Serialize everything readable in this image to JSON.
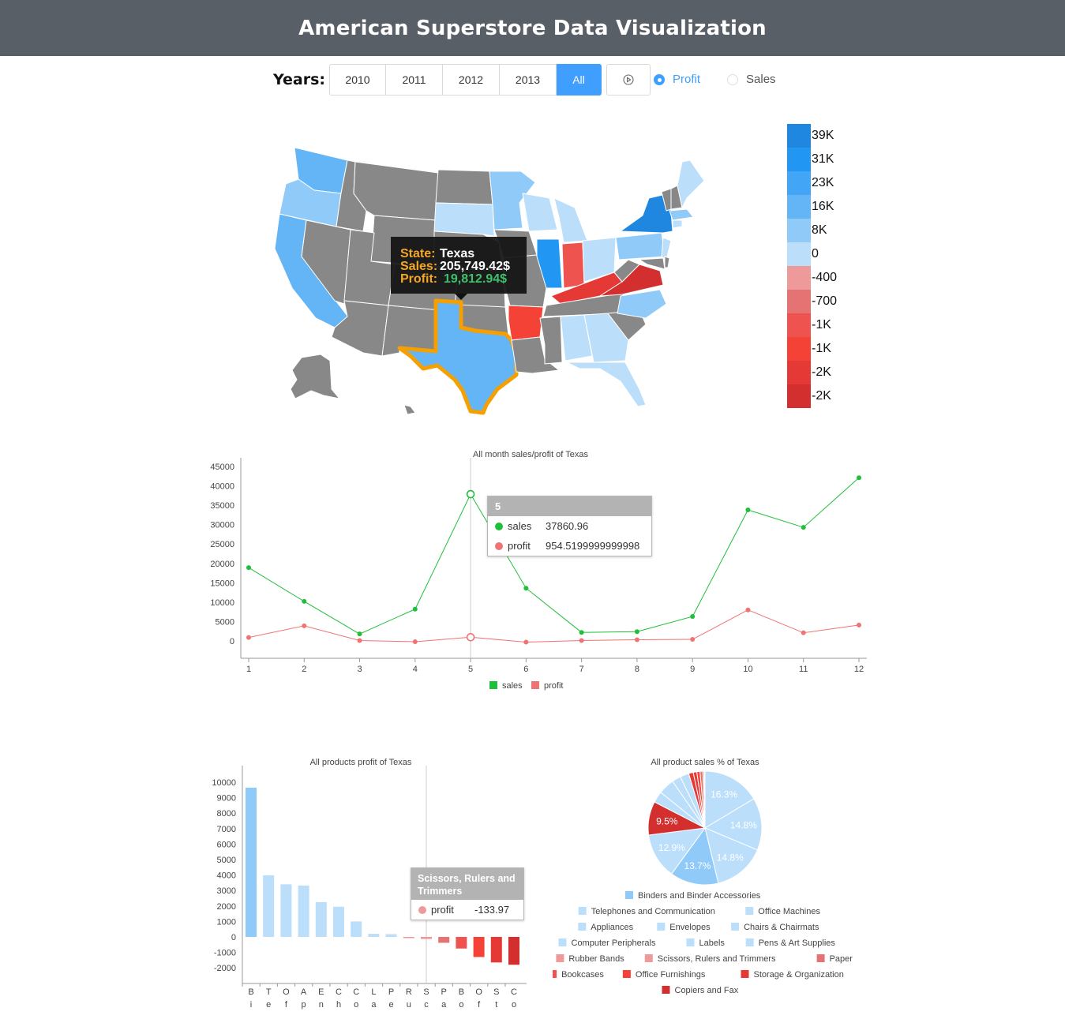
{
  "header": {
    "title": "American Superstore Data Visualization"
  },
  "controls": {
    "years_label": "Years:",
    "years": [
      "2010",
      "2011",
      "2012",
      "2013",
      "All"
    ],
    "selected_year": "All",
    "play_icon": "play-circle-icon",
    "radios": [
      {
        "label": "Profit",
        "checked": true
      },
      {
        "label": "Sales",
        "checked": false
      }
    ]
  },
  "colors": {
    "accent": "#409eff",
    "sales_line": "#1fbf3b",
    "profit_line": "#f07373",
    "tooltip_orange": "#f5a623",
    "tooltip_green": "#3fc06a",
    "highlight_state": "#f5a000",
    "no_data_state": "#888888"
  },
  "map": {
    "legend": [
      "39K",
      "31K",
      "23K",
      "16K",
      "8K",
      "0",
      "-400",
      "-700",
      "-1K",
      "-1K",
      "-2K",
      "-2K"
    ],
    "legend_colors": [
      "#1f87e0",
      "#2196f3",
      "#42a5f5",
      "#64b5f6",
      "#90caf9",
      "#bbdefb",
      "#ef9a9a",
      "#e57373",
      "#ef5350",
      "#f44336",
      "#e53935",
      "#d32f2f"
    ],
    "tooltip": {
      "state_label": "State:",
      "state_value": "Texas",
      "sales_label": "Sales:",
      "sales_value": "205,749.42$",
      "profit_label": "Profit:",
      "profit_value": "19,812.94$"
    }
  },
  "line_tooltip": {
    "title": "5",
    "rows": [
      {
        "name": "sales",
        "value": "37860.96"
      },
      {
        "name": "profit",
        "value": "954.5199999999998"
      }
    ]
  },
  "bar_tooltip": {
    "title": "Scissors, Rulers and Trimmers",
    "name": "profit",
    "value": "-133.97"
  },
  "chart_data": [
    {
      "type": "line",
      "title": "All month sales/profit of Texas",
      "x": [
        1,
        2,
        3,
        4,
        5,
        6,
        7,
        8,
        9,
        10,
        11,
        12
      ],
      "ylim": [
        0,
        45000
      ],
      "yticks": [
        0,
        5000,
        10000,
        15000,
        20000,
        25000,
        30000,
        35000,
        40000,
        45000
      ],
      "series": [
        {
          "name": "sales",
          "values": [
            18900,
            10200,
            1800,
            8200,
            37860.96,
            13600,
            2200,
            2400,
            6300,
            33800,
            29300,
            42100
          ]
        },
        {
          "name": "profit",
          "values": [
            900,
            3900,
            100,
            -200,
            954.52,
            -300,
            100,
            300,
            400,
            8000,
            2100,
            4100
          ]
        }
      ],
      "legend": [
        "sales",
        "profit"
      ],
      "legend_position": "bottom"
    },
    {
      "type": "bar",
      "title": "All products profit of Texas",
      "categories": [
        "Binders and Binder Accessories",
        "Telephones and Communication",
        "Office Machines",
        "Appliances",
        "Envelopes",
        "Chairs & Chairmats",
        "Computer Peripherals",
        "Labels",
        "Pens & Art Supplies",
        "Rubber Bands",
        "Scissors, Rulers and Trimmers",
        "Paper",
        "Bookcases",
        "Office Furnishings",
        "Storage & Organization",
        "Copiers and Fax"
      ],
      "tick_labels": [
        "B\ni",
        "T\ne",
        "O\nf",
        "A\np",
        "E\nn",
        "C\nh",
        "C\no",
        "L\na",
        "P\ne",
        "R\nu",
        "S\nc",
        "P\na",
        "B\no",
        "O\nf",
        "S\nt",
        "C\no"
      ],
      "values": [
        9650,
        3980,
        3400,
        3320,
        2250,
        1950,
        1000,
        200,
        180,
        -5,
        -133.97,
        -380,
        -750,
        -1300,
        -1650,
        -1800
      ],
      "ylim": [
        -2500,
        10500
      ],
      "yticks": [
        -2000,
        -1000,
        0,
        1000,
        2000,
        3000,
        4000,
        5000,
        6000,
        7000,
        8000,
        9000,
        10000
      ]
    },
    {
      "type": "pie",
      "title": "All product sales % of Texas",
      "labels": [
        "Binders and Binder Accessories",
        "Telephones and Communication",
        "Office Machines",
        "Appliances",
        "Envelopes",
        "Chairs & Chairmats",
        "Computer Peripherals",
        "Labels",
        "Pens & Art Supplies",
        "Rubber Bands",
        "Scissors, Rulers and Trimmers",
        "Paper",
        "Bookcases",
        "Office Furnishings",
        "Storage & Organization",
        "Copiers and Fax"
      ],
      "values": [
        16.3,
        14.8,
        14.8,
        13.7,
        12.9,
        9.5,
        4.5,
        3.2,
        2.5,
        2.5,
        1.4,
        1.0,
        0.9,
        0.8,
        0.6,
        0.6
      ],
      "slice_order": [
        "Binders and Binder Accessories",
        "Office Machines",
        "Telephones and Communication",
        "Chairs & Chairmats",
        "Computer Peripherals",
        "Appliances",
        "Copiers and Fax",
        "Envelopes",
        "Labels",
        "Pens & Art Supplies",
        "Office Furnishings",
        "Storage & Organization",
        "Bookcases",
        "Paper",
        "Scissors, Rulers and Trimmers",
        "Rubber Bands"
      ],
      "slice_values": [
        16.3,
        14.8,
        14.8,
        13.7,
        12.9,
        9.5,
        3.2,
        4.5,
        2.5,
        2.5,
        1.3,
        1.0,
        0.9,
        0.8,
        0.4,
        0.2
      ],
      "slice_colors": [
        "#bbdefb",
        "#bbdefb",
        "#bbdefb",
        "#90caf9",
        "#bbdefb",
        "#d32f2f",
        "#bbdefb",
        "#bbdefb",
        "#bbdefb",
        "#bbdefb",
        "#e53935",
        "#e53935",
        "#f44336",
        "#e57373",
        "#ef9a9a",
        "#ef9a9a"
      ],
      "legend_rows": [
        [
          "Binders and Binder Accessories"
        ],
        [
          "Telephones and Communication",
          "Office Machines"
        ],
        [
          "Appliances",
          "Envelopes",
          "Chairs & Chairmats"
        ],
        [
          "Computer Peripherals",
          "Labels",
          "Pens & Art Supplies"
        ],
        [
          "Rubber Bands",
          "Scissors, Rulers and Trimmers",
          "Paper"
        ],
        [
          "Bookcases",
          "Office Furnishings",
          "Storage & Organization"
        ],
        [
          "Copiers and Fax"
        ]
      ],
      "legend_colors": {
        "Binders and Binder Accessories": "#90caf9",
        "Telephones and Communication": "#bbdefb",
        "Office Machines": "#bbdefb",
        "Appliances": "#bbdefb",
        "Envelopes": "#bbdefb",
        "Chairs & Chairmats": "#bbdefb",
        "Computer Peripherals": "#bbdefb",
        "Labels": "#bbdefb",
        "Pens & Art Supplies": "#bbdefb",
        "Rubber Bands": "#ef9a9a",
        "Scissors, Rulers and Trimmers": "#ef9a9a",
        "Paper": "#e57373",
        "Bookcases": "#ef5350",
        "Office Furnishings": "#f44336",
        "Storage & Organization": "#e53935",
        "Copiers and Fax": "#d32f2f"
      },
      "shown_labels": [
        "16.3%",
        "14.8%",
        "14.8%",
        "13.7%",
        "12.9%",
        "9.5%"
      ]
    }
  ]
}
